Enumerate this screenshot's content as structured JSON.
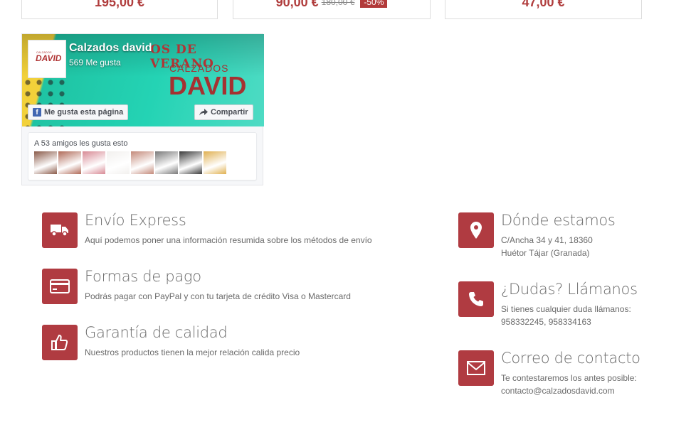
{
  "products": [
    {
      "price": "195,00 €"
    },
    {
      "price": "90,00 €",
      "old_price": "180,00 €",
      "discount": "-50%"
    },
    {
      "price": "47,00 €"
    }
  ],
  "facebook": {
    "page_name": "Calzados david",
    "likes": "569 Me gusta",
    "cover_text": "OS DE VERANO",
    "cover_brand_small": "CALZADOS",
    "cover_brand_big": "DAVID",
    "logo_small": "CALZADOS",
    "logo_big": "DAVID",
    "like_button": "Me gusta esta página",
    "share_button": "Compartir",
    "friends_text": "A 53 amigos les gusta esto",
    "friend_colors": [
      "#8a5a48",
      "#b06a58",
      "#d88a95",
      "#f2f0ee",
      "#c48a7a",
      "#7a7a7a",
      "#3a3a3a",
      "#e0b050"
    ]
  },
  "features_left": [
    {
      "icon": "truck-icon",
      "title": "Envío Express",
      "lines": [
        "Aquí podemos poner una información resumida sobre los métodos de envío"
      ]
    },
    {
      "icon": "credit-card-icon",
      "title": "Formas de pago",
      "lines": [
        "Podrás pagar con PayPal y con tu tarjeta de crédito Visa o Mastercard"
      ]
    },
    {
      "icon": "thumbs-up-icon",
      "title": "Garantía de calidad",
      "lines": [
        "Nuestros productos tienen la mejor relación calida precio"
      ]
    }
  ],
  "features_right": [
    {
      "icon": "map-marker-icon",
      "title": "Dónde estamos",
      "lines": [
        "C/Ancha 34 y 41, 18360",
        "Huétor Tájar (Granada)"
      ]
    },
    {
      "icon": "phone-icon",
      "title": "¿Dudas? Llámanos",
      "lines": [
        "Si tienes cualquier duda llámanos:",
        "958332245, 958334163"
      ]
    },
    {
      "icon": "envelope-icon",
      "title": "Correo de contacto",
      "lines": [
        "Te contestaremos los antes posible:",
        "contacto@calzadosdavid.com"
      ]
    }
  ],
  "colors": {
    "accent": "#b03b41",
    "price": "#b03d3d",
    "facebook": "#4267b2"
  }
}
